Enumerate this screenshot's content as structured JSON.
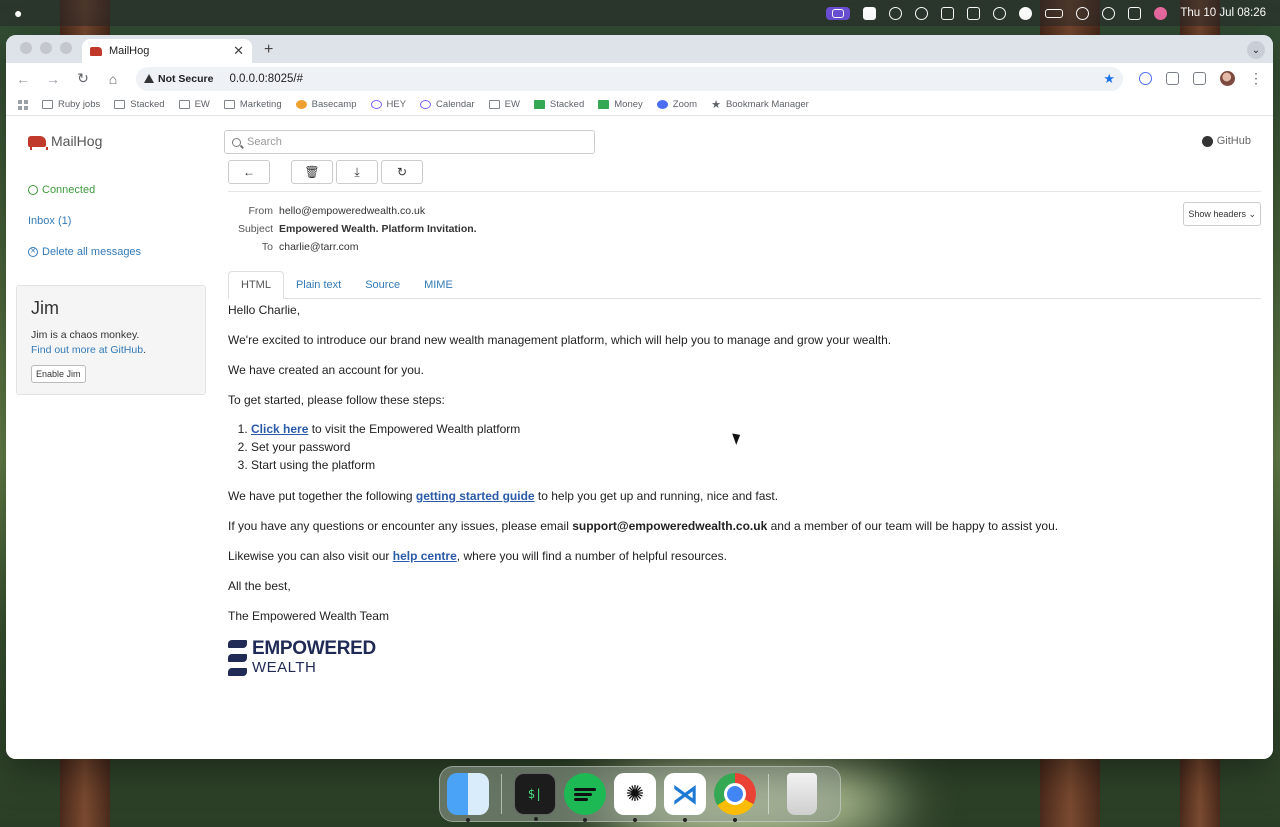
{
  "menubar": {
    "clock": "Thu 10 Jul  08:26"
  },
  "browser": {
    "tab_title": "MailHog",
    "security_label": "Not Secure",
    "url": "0.0.0.0:8025/#",
    "bookmarks": [
      "Ruby jobs",
      "Stacked",
      "EW",
      "Marketing",
      "Basecamp",
      "HEY",
      "Calendar",
      "EW",
      "Stacked",
      "Money",
      "Zoom",
      "Bookmark Manager"
    ]
  },
  "mailhog": {
    "brand": "MailHog",
    "search_placeholder": "Search",
    "github": "GitHub",
    "sidebar": {
      "connected": "Connected",
      "inbox": "Inbox (1)",
      "delete_all": "Delete all messages"
    },
    "jim": {
      "title": "Jim",
      "description": "Jim is a chaos monkey.",
      "link": "Find out more at GitHub",
      "link_suffix": ".",
      "button": "Enable Jim"
    },
    "actions": {
      "back": "←",
      "delete": "🗑",
      "download": "⤓",
      "release": "↻"
    },
    "message": {
      "from_label": "From",
      "from": "hello@empoweredwealth.co.uk",
      "subject_label": "Subject",
      "subject": "Empowered Wealth. Platform Invitation.",
      "to_label": "To",
      "to": "charlie@tarr.com",
      "show_headers": "Show headers ⌄"
    },
    "tabs": [
      "HTML",
      "Plain text",
      "Source",
      "MIME"
    ],
    "email": {
      "greeting": "Hello Charlie,",
      "intro": "We're excited to introduce our brand new wealth management platform, which will help you to manage and grow your wealth.",
      "account": "We have created an account for you.",
      "steps_intro": "To get started, please follow these steps:",
      "step1_link": "Click here",
      "step1_rest": " to visit the Empowered Wealth platform",
      "step2": "Set your password",
      "step3": "Start using the platform",
      "guide_pre": "We have put together the following ",
      "guide_link": "getting started guide",
      "guide_post": " to help you get up and running, nice and fast.",
      "support_pre": "If you have any questions or encounter any issues, please email ",
      "support_email": "support@empoweredwealth.co.uk",
      "support_post": " and a member of our team will be happy to assist you.",
      "help_pre": "Likewise you can also visit our ",
      "help_link": "help centre",
      "help_post": ", where you will find a number of helpful resources.",
      "signoff": "All the best,",
      "signature": "The Empowered Wealth Team",
      "logo_line1": "EMPOWERED",
      "logo_line2": "WEALTH"
    }
  },
  "dock": {
    "terminal_label": "$|"
  }
}
